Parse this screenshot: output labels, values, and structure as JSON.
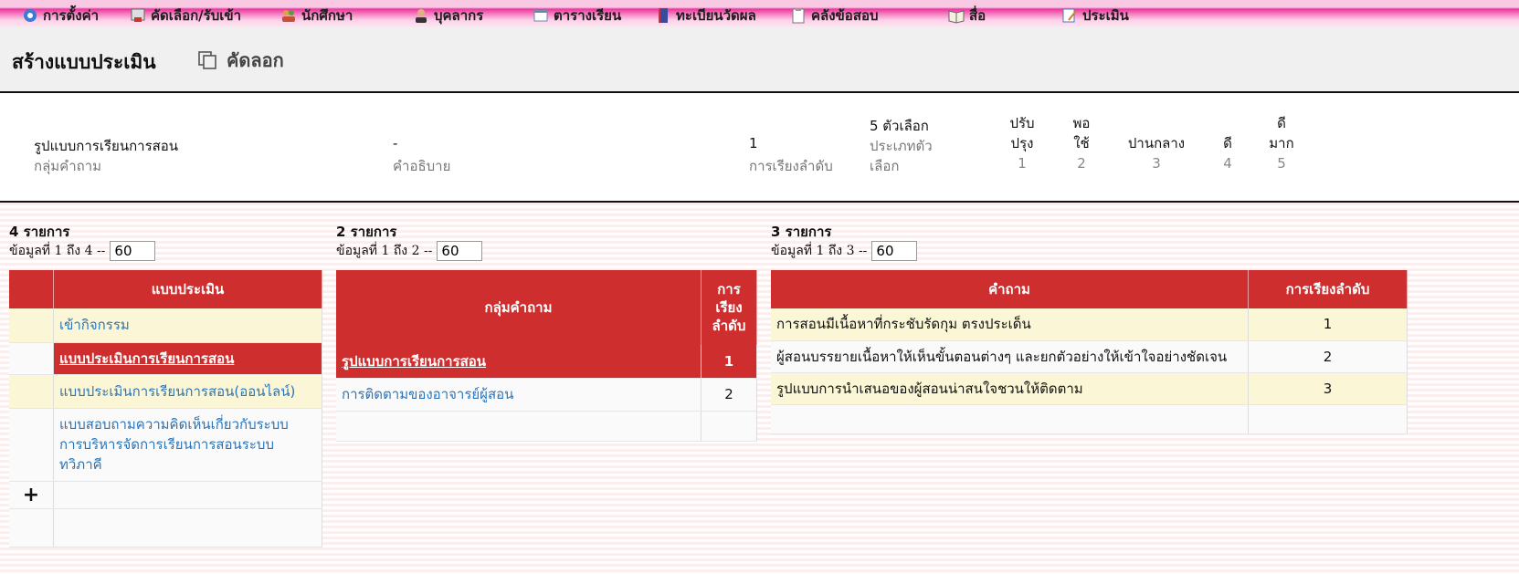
{
  "menu": [
    {
      "label": "การตั้งค่า",
      "icon": "gear-icon"
    },
    {
      "label": "คัดเลือก/รับเข้า",
      "icon": "admission-icon"
    },
    {
      "label": "นักศึกษา",
      "icon": "students-icon"
    },
    {
      "label": "บุคลากร",
      "icon": "staff-icon"
    },
    {
      "label": "ตารางเรียน",
      "icon": "calendar-icon"
    },
    {
      "label": "ทะเบียนวัดผล",
      "icon": "book-icon"
    },
    {
      "label": "คลังข้อสอบ",
      "icon": "clipboard-icon"
    },
    {
      "label": "สื่อ",
      "icon": "open-book-icon"
    },
    {
      "label": "ประเมิน",
      "icon": "evaluate-icon"
    }
  ],
  "page": {
    "title": "สร้างแบบประเมิน",
    "copy_label": "คัดลอก"
  },
  "info": {
    "group_value": "รูปแบบการเรียนการสอน",
    "group_label": "กลุ่มคำถาม",
    "desc_value": "-",
    "desc_label": "คำอธิบาย",
    "order_value": "1",
    "order_label": "การเรียงลำดับ",
    "choice_value": "5 ตัวเลือก",
    "choice_label_1": "ประเภทตัว",
    "choice_label_2": "เลือก",
    "scale": [
      {
        "l1": "ปรับ",
        "l2": "ปรุง",
        "n": "1"
      },
      {
        "l1": "พอ",
        "l2": "ใช้",
        "n": "2"
      },
      {
        "l1": "",
        "l2": "ปานกลาง",
        "n": "3"
      },
      {
        "l1": "",
        "l2": "ดี",
        "n": "4"
      },
      {
        "l1": "ดี",
        "l2": "มาก",
        "n": "5"
      }
    ]
  },
  "forms": {
    "count": "4 รายการ",
    "pager": "ข้อมูลที่ 1 ถึง 4 --",
    "page_size": "60",
    "header": "แบบประเมิน",
    "rows": [
      "เข้ากิจกรรม",
      "แบบประเมินการเรียนการสอน",
      "แบบประเมินการเรียนการสอน(ออนไลน์)",
      "แบบสอบถามความคิดเห็นเกี่ยวกับระบบ",
      "การบริหารจัดการเรียนการสอนระบบ",
      "ทวิภาคี"
    ],
    "add": "+"
  },
  "groups": {
    "count": "2 รายการ",
    "pager": "ข้อมูลที่ 1 ถึง 2 --",
    "page_size": "60",
    "header_name": "กลุ่มคำถาม",
    "header_order_1": "การ",
    "header_order_2": "เรียง",
    "header_order_3": "ลำดับ",
    "rows": [
      {
        "name": "รูปแบบการเรียนการสอน",
        "order": "1"
      },
      {
        "name": "การติดตามของอาจารย์ผู้สอน",
        "order": "2"
      }
    ]
  },
  "questions": {
    "count": "3 รายการ",
    "pager": "ข้อมูลที่ 1 ถึง 3 --",
    "page_size": "60",
    "header_q": "คำถาม",
    "header_order": "การเรียงลำดับ",
    "rows": [
      {
        "q": "การสอนมีเนื้อหาที่กระชับรัดกุม ตรงประเด็น",
        "order": "1"
      },
      {
        "q": "ผู้สอนบรรยายเนื้อหาให้เห็นขั้นตอนต่างๆ และยกตัวอย่างให้เข้าใจอย่างชัดเจน",
        "order": "2"
      },
      {
        "q": "รูปแบบการนำเสนอของผู้สอนน่าสนใจชวนให้ติดตาม",
        "order": "3"
      }
    ]
  }
}
